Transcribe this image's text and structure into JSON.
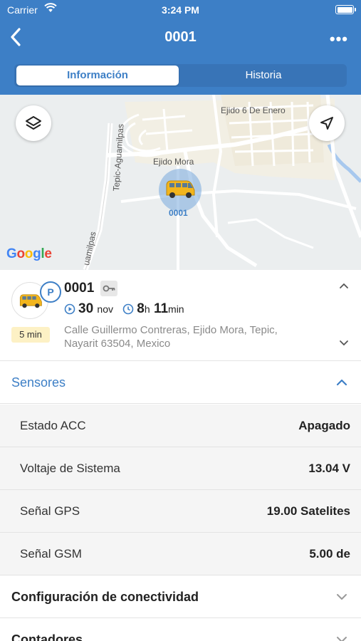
{
  "status_bar": {
    "carrier": "Carrier",
    "time": "3:24 PM"
  },
  "nav": {
    "title": "0001",
    "more": "•••"
  },
  "tabs": [
    {
      "label": "Información",
      "active": true
    },
    {
      "label": "Historia",
      "active": false
    }
  ],
  "map": {
    "labels": {
      "ejido_6": "Ejido 6 De Enero",
      "ejido_mora": "Ejido Mora",
      "tepic_aguamilpas": "Tepic-Aguamilpas",
      "uamilpas": "uamilpas",
      "marker": "0001"
    },
    "google_letters": [
      "G",
      "o",
      "o",
      "g",
      "l",
      "e"
    ],
    "google_colors": [
      "#4285F4",
      "#EA4335",
      "#FBBC05",
      "#4285F4",
      "#34A853",
      "#EA4335"
    ]
  },
  "vehicle": {
    "name": "0001",
    "parking_badge": "P",
    "time_tag": "5 min",
    "date_day": "30",
    "date_month": "nov",
    "duration_hours": "8",
    "duration_h_unit": "h",
    "duration_minutes": "11",
    "duration_min_unit": "min",
    "address": "Calle Guillermo Contreras, Ejido Mora, Tepic, Nayarit 63504, Mexico"
  },
  "sensors": {
    "title": "Sensores",
    "rows": [
      {
        "name": "Estado ACC",
        "value": "Apagado"
      },
      {
        "name": "Voltaje de Sistema",
        "value": "13.04 V"
      },
      {
        "name": "Señal GPS",
        "value": "19.00 Satelites"
      },
      {
        "name": "Señal GSM",
        "value": "5.00 de"
      }
    ]
  },
  "sections": {
    "connectivity": "Configuración de conectividad",
    "counters": "Contadores"
  },
  "colors": {
    "accent": "#3d7fc6",
    "time_tag_bg": "#fdf1c5"
  }
}
